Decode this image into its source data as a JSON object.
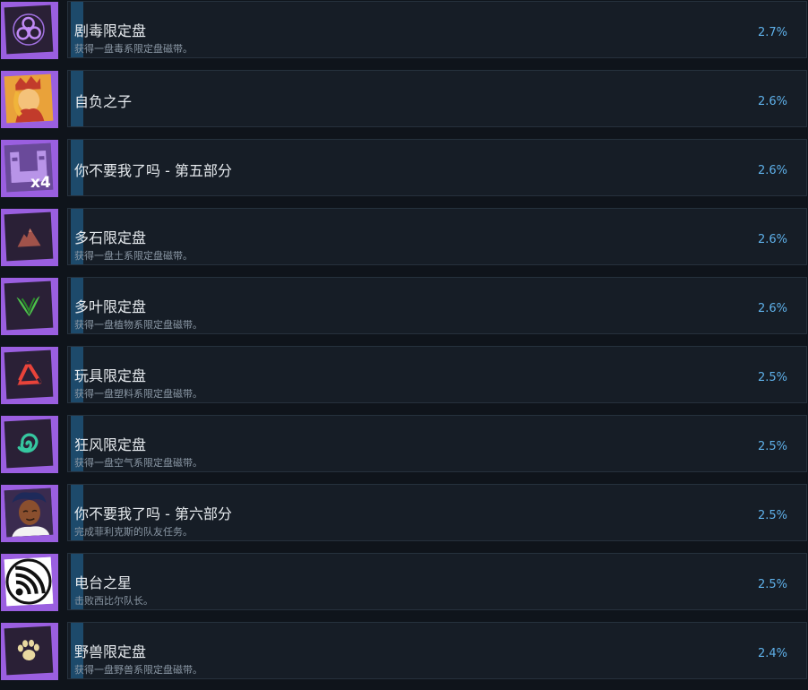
{
  "achievements": [
    {
      "title": "剧毒限定盘",
      "desc": "获得一盘毒系限定盘磁带。",
      "pct": "2.7%",
      "icon": "biohazard-icon"
    },
    {
      "title": "自负之子",
      "desc": "",
      "pct": "2.6%",
      "icon": "crowned-character-icon"
    },
    {
      "title": "你不要我了吗 - 第五部分",
      "desc": "",
      "pct": "2.6%",
      "icon": "tape-x4-icon",
      "badge": "x4"
    },
    {
      "title": "多石限定盘",
      "desc": "获得一盘土系限定盘磁带。",
      "pct": "2.6%",
      "icon": "rock-icon"
    },
    {
      "title": "多叶限定盘",
      "desc": "获得一盘植物系限定盘磁带。",
      "pct": "2.6%",
      "icon": "leaf-icon"
    },
    {
      "title": "玩具限定盘",
      "desc": "获得一盘塑料系限定盘磁带。",
      "pct": "2.5%",
      "icon": "recycle-icon"
    },
    {
      "title": "狂风限定盘",
      "desc": "获得一盘空气系限定盘磁带。",
      "pct": "2.5%",
      "icon": "spiral-wind-icon"
    },
    {
      "title": "你不要我了吗 - 第六部分",
      "desc": "完成菲利克斯的队友任务。",
      "pct": "2.5%",
      "icon": "character-portrait-icon"
    },
    {
      "title": "电台之星",
      "desc": "击败西比尔队长。",
      "pct": "2.5%",
      "icon": "radio-signal-icon"
    },
    {
      "title": "野兽限定盘",
      "desc": "获得一盘野兽系限定盘磁带。",
      "pct": "2.4%",
      "icon": "paw-icon"
    }
  ],
  "colors": {
    "accent": "#1d4a6b",
    "percent": "#5fb1ea",
    "frame": "#9a5fe0"
  }
}
